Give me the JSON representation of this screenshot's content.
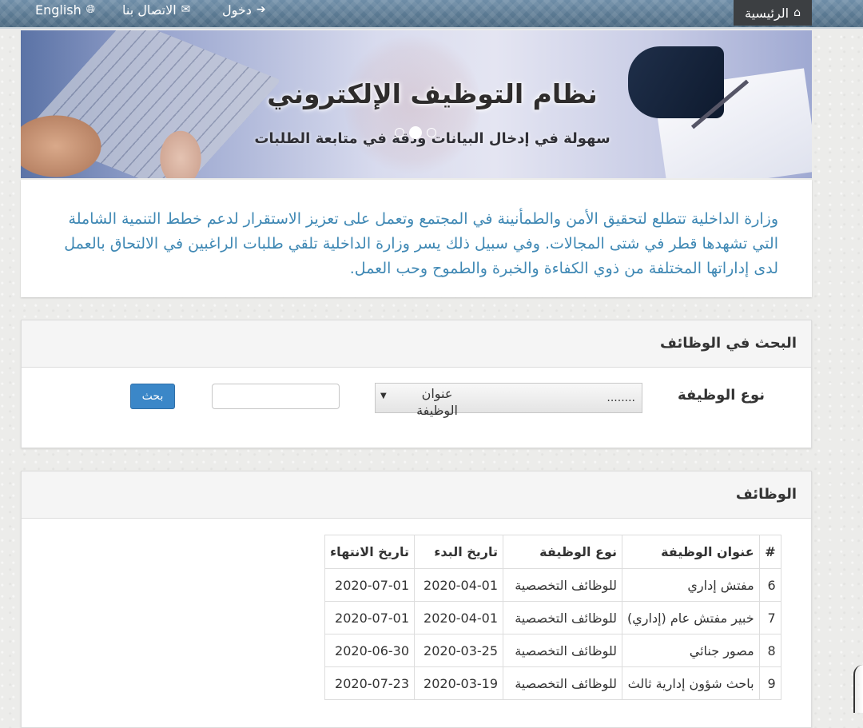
{
  "nav": {
    "english": "English",
    "contact": "الاتصال بنا",
    "login": "دخول",
    "home": "الرئيسية"
  },
  "banner": {
    "title": "نظام التوظيف الإلكتروني",
    "subtitle": "سهولة في إدخال البيانات ودقة في متابعة الطلبات"
  },
  "intro": {
    "text": "وزارة الداخلية تتطلع لتحقيق الأمن والطمأنينة في المجتمع وتعمل على تعزيز الاستقرار لدعم خطط التنمية الشاملة التي تشهدها قطر في شتى المجالات. وفي سبيل ذلك يسر وزارة الداخلية تلقي طلبات الراغبين في الالتحاق بالعمل لدى إداراتها المختلفة من ذوي الكفاءة والخبرة والطموح وحب العمل."
  },
  "search": {
    "heading": "البحث في الوظائف",
    "type_label": "نوع الوظيفة",
    "select_placeholder": "........",
    "select_option": "عنوان الوظيفة",
    "button": "بحث"
  },
  "jobs": {
    "heading": "الوظائف",
    "columns": [
      "#",
      "عنوان الوظيفة",
      "نوع الوظيفة",
      "تاريخ البدء",
      "تاريخ الانتهاء"
    ],
    "rows": [
      {
        "num": "6",
        "title": "مفتش إداري",
        "type": "للوظائف التخصصية",
        "start": "2020-04-01",
        "end": "2020-07-01"
      },
      {
        "num": "7",
        "title": "خبير مفتش عام (إداري)",
        "type": "للوظائف التخصصية",
        "start": "2020-04-01",
        "end": "2020-07-01"
      },
      {
        "num": "8",
        "title": "مصور جنائي",
        "type": "للوظائف التخصصية",
        "start": "2020-03-25",
        "end": "2020-06-30"
      },
      {
        "num": "9",
        "title": "باحث شؤون إدارية ثالث",
        "type": "للوظائف التخصصية",
        "start": "2020-03-19",
        "end": "2020-07-23"
      }
    ]
  }
}
